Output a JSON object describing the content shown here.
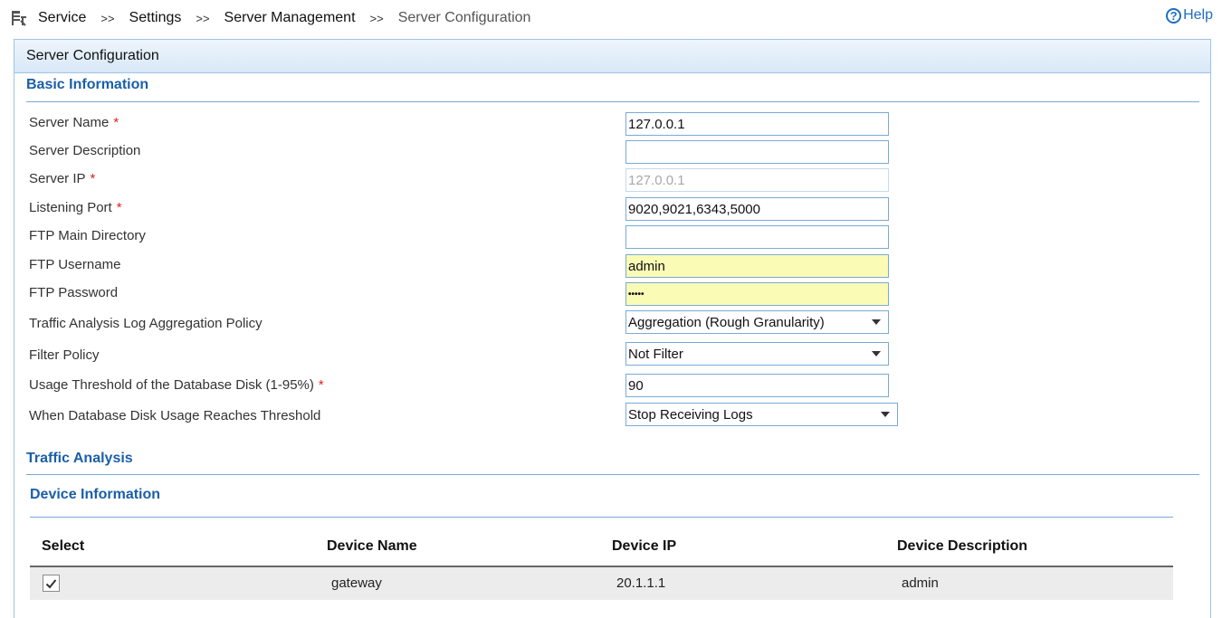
{
  "breadcrumb": {
    "items": [
      "Service",
      "Settings",
      "Server Management",
      "Server Configuration"
    ],
    "separator": ">>"
  },
  "help": {
    "icon_symbol": "?",
    "label": "Help"
  },
  "panel": {
    "title": "Server Configuration"
  },
  "basic_info": {
    "title": "Basic Information",
    "fields": {
      "server_name": {
        "label": "Server Name",
        "value": "127.0.0.1",
        "required": "*"
      },
      "server_description": {
        "label": "Server Description",
        "value": ""
      },
      "server_ip": {
        "label": "Server IP",
        "value": "127.0.0.1",
        "required": "*"
      },
      "listening_port": {
        "label": "Listening Port",
        "value": "9020,9021,6343,5000",
        "required": "*"
      },
      "ftp_main_directory": {
        "label": "FTP Main Directory",
        "value": ""
      },
      "ftp_username": {
        "label": "FTP Username",
        "value": "admin"
      },
      "ftp_password": {
        "label": "FTP Password",
        "value": "•••••"
      },
      "aggregation_policy": {
        "label": "Traffic Analysis Log Aggregation Policy",
        "value": "Aggregation (Rough Granularity)"
      },
      "filter_policy": {
        "label": "Filter Policy",
        "value": "Not Filter"
      },
      "usage_threshold": {
        "label": "Usage Threshold of the Database Disk (1-95%)",
        "value": "90",
        "required": "*"
      },
      "threshold_action": {
        "label": "When Database Disk Usage Reaches Threshold",
        "value": "Stop Receiving Logs"
      }
    }
  },
  "traffic_analysis": {
    "title": "Traffic Analysis"
  },
  "device_info": {
    "title": "Device Information",
    "columns": [
      "Select",
      "Device Name",
      "Device IP",
      "Device Description"
    ],
    "rows": [
      {
        "selected": true,
        "name": "gateway",
        "ip": "20.1.1.1",
        "description": "admin"
      }
    ]
  },
  "colors": {
    "accent": "#1a5fa8",
    "border": "#7aaad6",
    "required": "#dd2222",
    "highlight_field": "#fafcb6"
  }
}
